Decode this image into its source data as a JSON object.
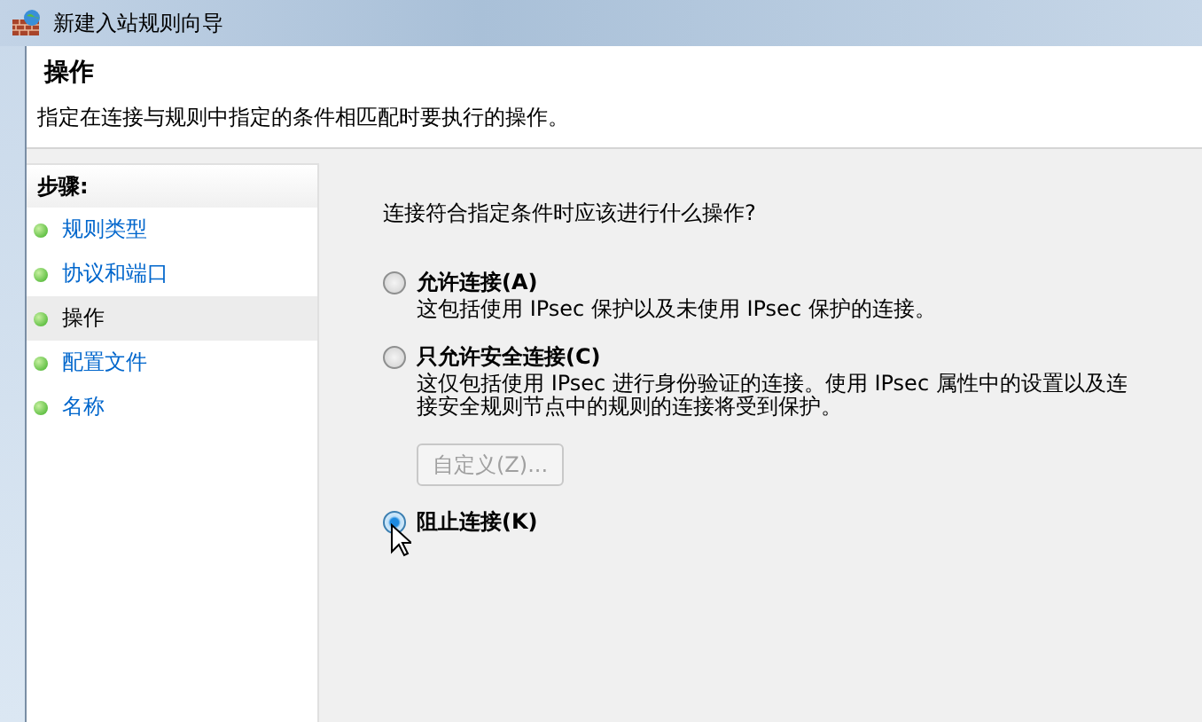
{
  "window": {
    "title": "新建入站规则向导"
  },
  "header": {
    "title": "操作",
    "subtitle": "指定在连接与规则中指定的条件相匹配时要执行的操作。"
  },
  "steps": {
    "title": "步骤:",
    "items": [
      {
        "label": "规则类型",
        "selected": false
      },
      {
        "label": "协议和端口",
        "selected": false
      },
      {
        "label": "操作",
        "selected": true
      },
      {
        "label": "配置文件",
        "selected": false
      },
      {
        "label": "名称",
        "selected": false
      }
    ]
  },
  "question": "连接符合指定条件时应该进行什么操作?",
  "options": [
    {
      "label": "允许连接(A)",
      "description": "这包括使用 IPsec 保护以及未使用 IPsec 保护的连接。",
      "selected": false
    },
    {
      "label": "只允许安全连接(C)",
      "description": "这仅包括使用 IPsec 进行身份验证的连接。使用 IPsec 属性中的设置以及连接安全规则节点中的规则的连接将受到保护。",
      "selected": false,
      "button": {
        "label": "自定义(Z)...",
        "disabled": true
      }
    },
    {
      "label": "阻止连接(K)",
      "selected": true
    }
  ]
}
